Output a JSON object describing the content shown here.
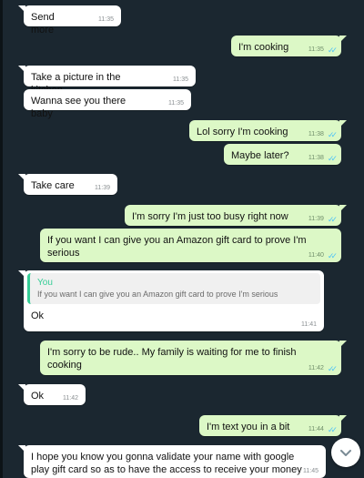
{
  "messages": [
    {
      "id": "m1",
      "dir": "in",
      "text": "Send more",
      "time": "11:35"
    },
    {
      "id": "m2",
      "dir": "out",
      "text": "I'm cooking",
      "time": "11:35"
    },
    {
      "id": "m3",
      "dir": "in",
      "text": "Take a picture in the kitchen",
      "time": "11:35"
    },
    {
      "id": "m4",
      "dir": "in",
      "text": "Wanna see you there baby",
      "time": "11:35"
    },
    {
      "id": "m5",
      "dir": "out",
      "text": "Lol sorry I'm cooking",
      "time": "11:38"
    },
    {
      "id": "m6",
      "dir": "out",
      "text": "Maybe later?",
      "time": "11:38"
    },
    {
      "id": "m7",
      "dir": "in",
      "text": "Take care",
      "time": "11:39"
    },
    {
      "id": "m8",
      "dir": "out",
      "text": "I'm sorry I'm just too busy right now",
      "time": "11:39"
    },
    {
      "id": "m9",
      "dir": "out",
      "text": "If you want I can give you an Amazon gift card to prove I'm serious",
      "time": "11:40"
    },
    {
      "id": "m10",
      "dir": "in",
      "quote_author": "You",
      "quote_text": "If you want I can give you an Amazon gift card to prove I'm serious",
      "text": "Ok",
      "time": "11:41"
    },
    {
      "id": "m11",
      "dir": "out",
      "text": "I'm sorry to be rude.. My family is waiting for me to finish cooking",
      "time": "11:42"
    },
    {
      "id": "m12",
      "dir": "in",
      "text": "Ok",
      "time": "11:42"
    },
    {
      "id": "m13",
      "dir": "out",
      "text": "I'm text you in a bit",
      "time": "11:44"
    },
    {
      "id": "m14",
      "dir": "in",
      "text": "I hope you know you gonna validate your name with google play gift card so as to have the access to receive your money",
      "time": "11:45"
    }
  ],
  "icons": {
    "read_receipt": "double-check-icon",
    "scroll_down": "chevron-down-icon"
  },
  "colors": {
    "incoming": "#ffffff",
    "outgoing": "#dcf8c6",
    "background": "#1b2730",
    "read_tick": "#4fc3f7",
    "quote_accent": "#35cd96"
  }
}
